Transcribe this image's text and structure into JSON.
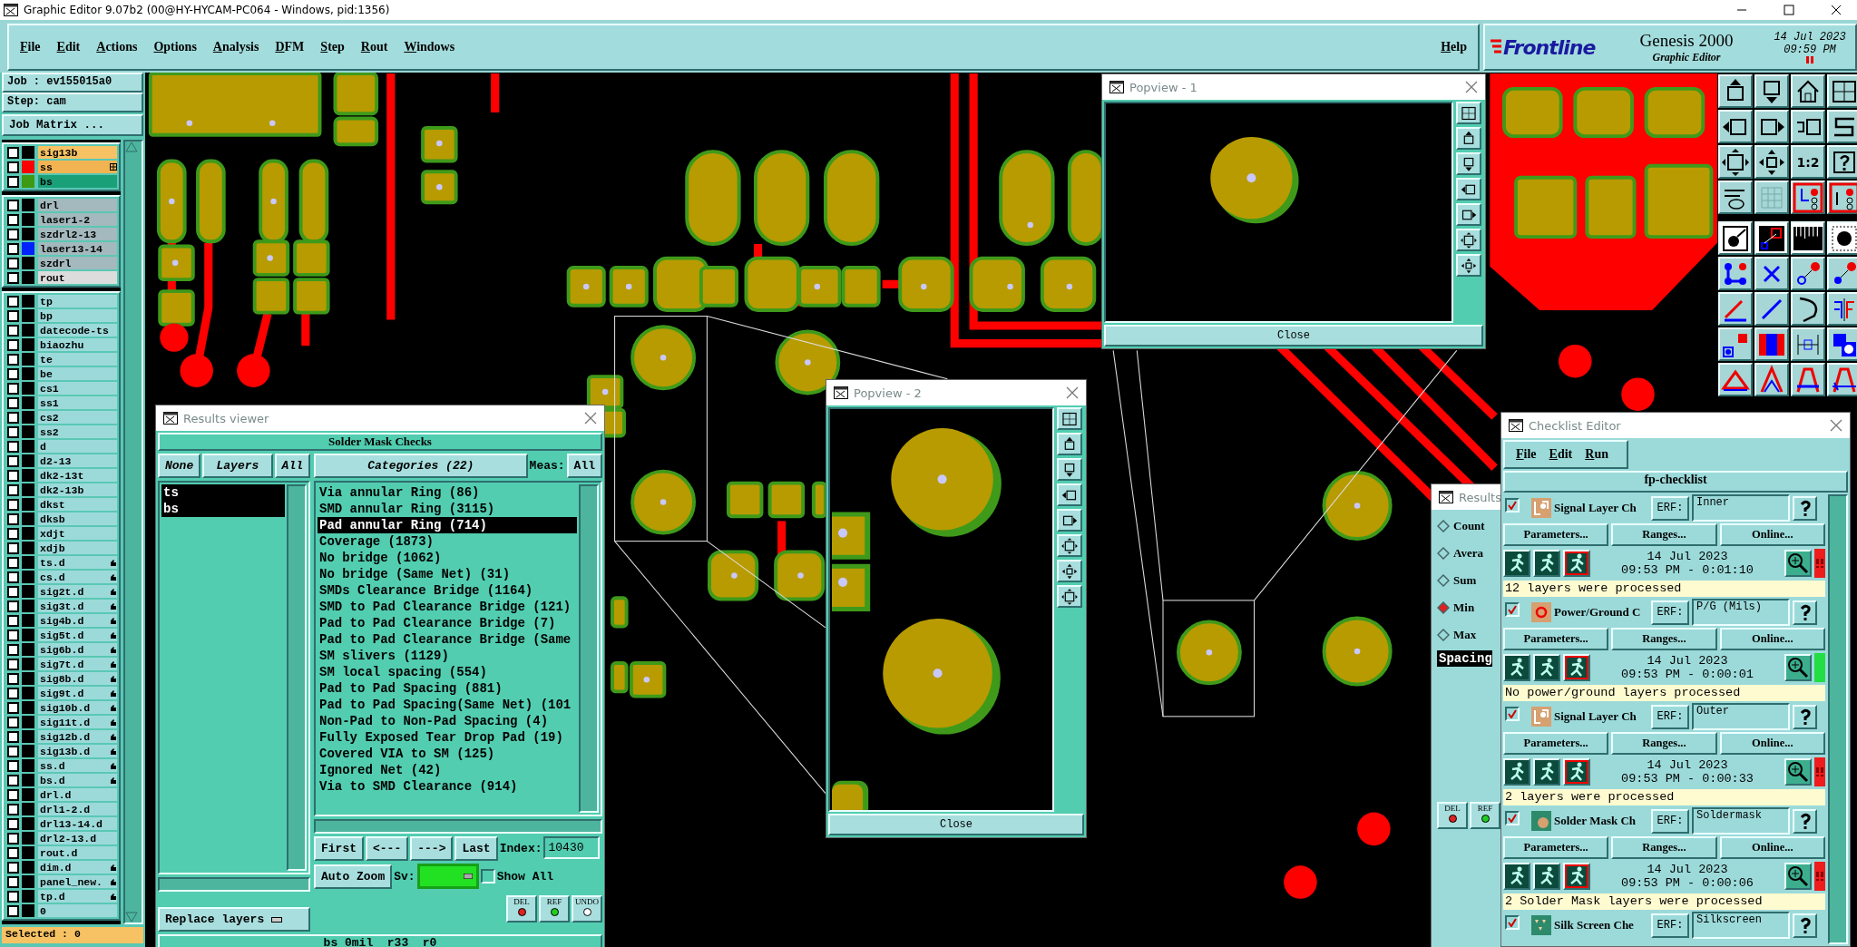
{
  "title_bar": {
    "title": "Graphic Editor 9.07b2 (00@HY-HYCAM-PC064 - Windows, pid:1356)"
  },
  "menu": [
    "File",
    "Edit",
    "Actions",
    "Options",
    "Analysis",
    "DFM",
    "Step",
    "Rout",
    "Windows"
  ],
  "help": "Help",
  "logo": {
    "brand": "Frontline",
    "product": "Genesis 2000",
    "subtitle": "Graphic Editor",
    "date": "14 Jul 2023",
    "time": "09:59 PM"
  },
  "job_panel": {
    "job": "Job : ev155015a0",
    "step": "Step: cam",
    "matrix_button": "Job Matrix ...",
    "selected": "Selected : 0",
    "layer_groups": [
      {
        "layers": [
          {
            "name": "sig13b",
            "kind": "signal",
            "work": false,
            "checked": false,
            "marked": false
          },
          {
            "name": "ss",
            "kind": "mask",
            "work": false,
            "checked": false,
            "marked": true,
            "color": "#ff0000"
          },
          {
            "name": "bs",
            "kind": "mask",
            "work": true,
            "checked": false,
            "marked": false,
            "color": "#3c9a14"
          }
        ]
      },
      {
        "layers": [
          {
            "name": "drl",
            "kind": "drill",
            "work": false,
            "checked": false,
            "marked": false
          },
          {
            "name": "laser1-2",
            "kind": "drill",
            "work": false,
            "checked": false,
            "marked": false
          },
          {
            "name": "szdrl2-13",
            "kind": "drill",
            "work": false,
            "checked": false,
            "marked": false
          },
          {
            "name": "laser13-14",
            "kind": "drill",
            "work": false,
            "checked": false,
            "marked": false,
            "color": "#0022ff"
          },
          {
            "name": "szdrl",
            "kind": "drill",
            "work": false,
            "checked": false,
            "marked": false
          },
          {
            "name": "rout",
            "kind": "rout",
            "work": false,
            "checked": false,
            "marked": false
          }
        ]
      },
      {
        "layers": [
          {
            "name": "tp",
            "kind": "misc",
            "work": false,
            "checked": false,
            "marked": false
          },
          {
            "name": "bp",
            "kind": "misc",
            "work": false,
            "checked": false,
            "marked": false
          },
          {
            "name": "datecode-ts",
            "kind": "misc",
            "work": false,
            "checked": false,
            "marked": false
          },
          {
            "name": "biaozhu",
            "kind": "misc",
            "work": false,
            "checked": false,
            "marked": false
          },
          {
            "name": "te",
            "kind": "misc",
            "work": false,
            "checked": false,
            "marked": false
          },
          {
            "name": "be",
            "kind": "misc",
            "work": false,
            "checked": false,
            "marked": false
          },
          {
            "name": "cs1",
            "kind": "misc",
            "work": false,
            "checked": false,
            "marked": false
          },
          {
            "name": "ss1",
            "kind": "misc",
            "work": false,
            "checked": false,
            "marked": false
          },
          {
            "name": "cs2",
            "kind": "misc",
            "work": false,
            "checked": false,
            "marked": false
          },
          {
            "name": "ss2",
            "kind": "misc",
            "work": false,
            "checked": false,
            "marked": false
          },
          {
            "name": "d",
            "kind": "misc",
            "work": false,
            "checked": false,
            "marked": false
          },
          {
            "name": "d2-13",
            "kind": "misc",
            "work": false,
            "checked": false,
            "marked": false
          },
          {
            "name": "dk2-13t",
            "kind": "misc",
            "work": false,
            "checked": false,
            "marked": false
          },
          {
            "name": "dk2-13b",
            "kind": "misc",
            "work": false,
            "checked": false,
            "marked": false
          },
          {
            "name": "dkst",
            "kind": "misc",
            "work": false,
            "checked": false,
            "marked": false
          },
          {
            "name": "dksb",
            "kind": "misc",
            "work": false,
            "checked": false,
            "marked": false
          },
          {
            "name": "xdjt",
            "kind": "misc",
            "work": false,
            "checked": false,
            "marked": false
          },
          {
            "name": "xdjb",
            "kind": "misc",
            "work": false,
            "checked": false,
            "marked": false
          },
          {
            "name": "ts.d",
            "kind": "misc",
            "work": false,
            "checked": false,
            "marked": true
          },
          {
            "name": "cs.d",
            "kind": "misc",
            "work": false,
            "checked": false,
            "marked": true
          },
          {
            "name": "sig2t.d",
            "kind": "misc",
            "work": false,
            "checked": false,
            "marked": true
          },
          {
            "name": "sig3t.d",
            "kind": "misc",
            "work": false,
            "checked": false,
            "marked": true
          },
          {
            "name": "sig4b.d",
            "kind": "misc",
            "work": false,
            "checked": false,
            "marked": true
          },
          {
            "name": "sig5t.d",
            "kind": "misc",
            "work": false,
            "checked": false,
            "marked": true
          },
          {
            "name": "sig6b.d",
            "kind": "misc",
            "work": false,
            "checked": false,
            "marked": true
          },
          {
            "name": "sig7t.d",
            "kind": "misc",
            "work": false,
            "checked": false,
            "marked": true
          },
          {
            "name": "sig8b.d",
            "kind": "misc",
            "work": false,
            "checked": false,
            "marked": true
          },
          {
            "name": "sig9t.d",
            "kind": "misc",
            "work": false,
            "checked": false,
            "marked": true
          },
          {
            "name": "sig10b.d",
            "kind": "misc",
            "work": false,
            "checked": false,
            "marked": true
          },
          {
            "name": "sig11t.d",
            "kind": "misc",
            "work": false,
            "checked": false,
            "marked": true
          },
          {
            "name": "sig12b.d",
            "kind": "misc",
            "work": false,
            "checked": false,
            "marked": true
          },
          {
            "name": "sig13b.d",
            "kind": "misc",
            "work": false,
            "checked": false,
            "marked": true
          },
          {
            "name": "ss.d",
            "kind": "misc",
            "work": false,
            "checked": false,
            "marked": true
          },
          {
            "name": "bs.d",
            "kind": "misc",
            "work": false,
            "checked": false,
            "marked": true
          },
          {
            "name": "drl.d",
            "kind": "misc",
            "work": false,
            "checked": false,
            "marked": false
          },
          {
            "name": "drl1-2.d",
            "kind": "misc",
            "work": false,
            "checked": false,
            "marked": false
          },
          {
            "name": "drl13-14.d",
            "kind": "misc",
            "work": false,
            "checked": false,
            "marked": false
          },
          {
            "name": "drl2-13.d",
            "kind": "misc",
            "work": false,
            "checked": false,
            "marked": false
          },
          {
            "name": "rout.d",
            "kind": "misc",
            "work": false,
            "checked": false,
            "marked": false
          },
          {
            "name": "dim.d",
            "kind": "misc",
            "work": false,
            "checked": false,
            "marked": true
          },
          {
            "name": "panel_new.",
            "kind": "misc",
            "work": false,
            "checked": false,
            "marked": true
          },
          {
            "name": "tp.d",
            "kind": "misc",
            "work": false,
            "checked": false,
            "marked": true
          },
          {
            "name": "0",
            "kind": "misc",
            "work": false,
            "checked": false,
            "marked": false
          }
        ]
      }
    ]
  },
  "toolbar": {
    "scale_button": "1:2"
  },
  "results_viewer": {
    "title": "Results viewer",
    "heading": "Solder Mask Checks",
    "layer_buttons": [
      "None",
      "Layers",
      "All"
    ],
    "layers": [
      {
        "name": "ts",
        "selected": true
      },
      {
        "name": "bs",
        "selected": true
      }
    ],
    "categories_button": "Categories (22)",
    "meas_label": "Meas:",
    "meas_value": "All",
    "categories": [
      {
        "label": "Via annular Ring (86)",
        "selected": false
      },
      {
        "label": "SMD annular Ring (3115)",
        "selected": false
      },
      {
        "label": "Pad annular Ring (714)",
        "selected": true
      },
      {
        "label": "Coverage (1873)",
        "selected": false
      },
      {
        "label": "No bridge (1062)",
        "selected": false
      },
      {
        "label": "No bridge (Same Net) (31)",
        "selected": false
      },
      {
        "label": "SMDs Clearance Bridge (1164)",
        "selected": false
      },
      {
        "label": "SMD to Pad Clearance Bridge (121)",
        "selected": false
      },
      {
        "label": "Pad to Pad Clearance Bridge (7)",
        "selected": false
      },
      {
        "label": "Pad to Pad Clearance Bridge (Same",
        "selected": false
      },
      {
        "label": "SM slivers (1129)",
        "selected": false
      },
      {
        "label": "SM local spacing (554)",
        "selected": false
      },
      {
        "label": "Pad to Pad Spacing (881)",
        "selected": false
      },
      {
        "label": "Pad to Pad Spacing(Same Net) (101",
        "selected": false
      },
      {
        "label": "Non-Pad to Non-Pad Spacing (4)",
        "selected": false
      },
      {
        "label": "Fully Exposed Tear Drop Pad (19)",
        "selected": false
      },
      {
        "label": "Covered VIA to SM (125)",
        "selected": false
      },
      {
        "label": "Ignored Net (42)",
        "selected": false
      },
      {
        "label": "Via to SMD Clearance (914)",
        "selected": false
      }
    ],
    "nav_buttons": [
      "First",
      "<---",
      "--->",
      "Last"
    ],
    "index_label": "Index:",
    "index_value": "10430",
    "zoom_mode": "Auto Zoom",
    "sv_label": "Sv:",
    "show_all": {
      "label": "Show All",
      "checked": false
    },
    "replace_button": "Replace layers",
    "actions": [
      "DEL",
      "REF",
      "UNDO"
    ],
    "status": "bs 0mil  r33  r0"
  },
  "popviews": [
    {
      "title": "Popview - 1",
      "close": "Close"
    },
    {
      "title": "Popview - 2",
      "close": "Close"
    }
  ],
  "results_small": {
    "title": "Results",
    "modes": [
      {
        "label": "Count",
        "selected": false
      },
      {
        "label": "Avera",
        "selected": false
      },
      {
        "label": "Sum",
        "selected": false
      },
      {
        "label": "Min",
        "selected": true
      },
      {
        "label": "Max",
        "selected": false
      }
    ],
    "items": [
      {
        "label": "Spacing",
        "selected": true
      }
    ],
    "actions": [
      "DEL",
      "REF"
    ]
  },
  "checklist": {
    "title": "Checklist Editor",
    "menu": [
      "File",
      "Edit",
      "Run"
    ],
    "name": "fp-checklist",
    "checks": [
      {
        "enabled": true,
        "kind": "signal",
        "name": "Signal Layer Ch",
        "erf_label": "ERF:",
        "erf": "Inner",
        "buttons": [
          "Parameters...",
          "Ranges...",
          "Online..."
        ],
        "date": "14 Jul 2023",
        "time": "09:53 PM - 0:01:10",
        "failed": true,
        "message": "12 layers were processed"
      },
      {
        "enabled": true,
        "kind": "power",
        "name": "Power/Ground C",
        "erf_label": "ERF:",
        "erf": "P/G (Mils)",
        "buttons": [
          "Parameters...",
          "Ranges...",
          "Online..."
        ],
        "date": "14 Jul 2023",
        "time": "09:53 PM - 0:00:01",
        "failed": false,
        "message": "No power/ground layers processed"
      },
      {
        "enabled": true,
        "kind": "signal",
        "name": "Signal Layer Ch",
        "erf_label": "ERF:",
        "erf": "Outer",
        "buttons": [
          "Parameters...",
          "Ranges...",
          "Online..."
        ],
        "date": "14 Jul 2023",
        "time": "09:53 PM - 0:00:33",
        "failed": true,
        "message": "2 layers were processed"
      },
      {
        "enabled": true,
        "kind": "mask",
        "name": "Solder Mask Ch",
        "erf_label": "ERF:",
        "erf": "Soldermask",
        "buttons": [
          "Parameters...",
          "Ranges...",
          "Online..."
        ],
        "date": "14 Jul 2023",
        "time": "09:53 PM - 0:00:06",
        "failed": true,
        "message": "2 Solder Mask layers were processed"
      },
      {
        "enabled": true,
        "kind": "silk",
        "name": "Silk Screen Che",
        "erf_label": "ERF:",
        "erf": "Silkscreen"
      }
    ]
  }
}
